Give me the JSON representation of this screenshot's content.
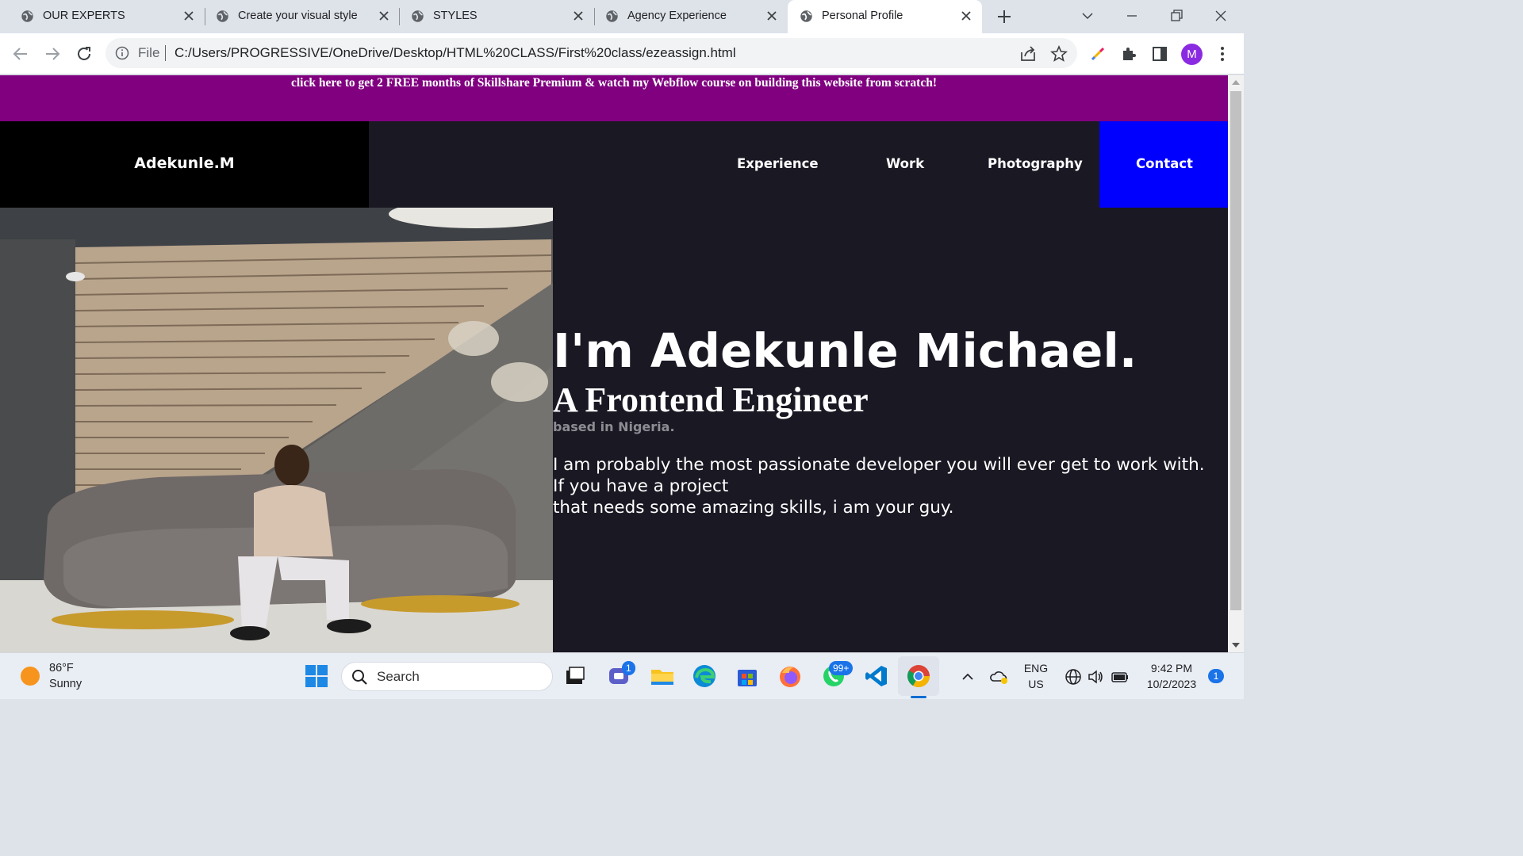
{
  "browser": {
    "tabs": [
      {
        "title": "OUR EXPERTS",
        "active": false
      },
      {
        "title": "Create your visual style",
        "active": false
      },
      {
        "title": "STYLES",
        "active": false
      },
      {
        "title": "Agency Experience",
        "active": false
      },
      {
        "title": "Personal Profile",
        "active": true
      }
    ],
    "address": {
      "scheme": "File",
      "url": "C:/Users/PROGRESSIVE/OneDrive/Desktop/HTML%20CLASS/First%20class/ezeassign.html"
    },
    "profile_initial": "M"
  },
  "page": {
    "promo": "click here to get 2 FREE months of Skillshare Premium & watch my Webflow course on building this website from scratch!",
    "brand": "Adekunle.M",
    "nav": [
      "Experience",
      "Work",
      "Photography",
      "Contact"
    ],
    "hero": {
      "heading": "I'm Adekunle Michael.",
      "subheading": "A Frontend Engineer",
      "location": "based in Nigeria.",
      "paragraph_lines": [
        "I am probably the most passionate developer you will ever get to work with.",
        "If you have a project",
        "that needs some amazing skills, i am your guy."
      ]
    },
    "colors": {
      "promo_bg": "#800080",
      "page_bg": "#1a1823",
      "contact_bg": "#0000ff",
      "brand_bg": "#000000"
    }
  },
  "taskbar": {
    "weather": {
      "temp": "86°F",
      "condition": "Sunny"
    },
    "search_label": "Search",
    "badges": {
      "teams": "1",
      "whatsapp": "99+",
      "notifications": "1"
    },
    "language": {
      "lang": "ENG",
      "region": "US"
    },
    "clock": {
      "time": "9:42 PM",
      "date": "10/2/2023"
    }
  }
}
